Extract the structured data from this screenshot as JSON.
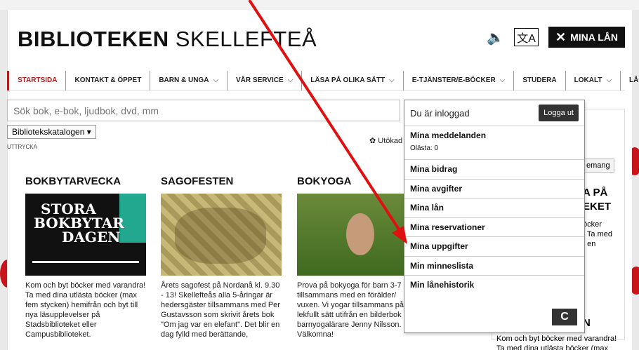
{
  "header": {
    "logo_bold": "BIBLIOTEKEN",
    "logo_light": "SKELLEFTEÅ",
    "mina_lan": "MINA LÅN",
    "icons": [
      "speaker-icon",
      "translate-icon",
      "close-icon"
    ]
  },
  "nav": {
    "items": [
      {
        "label": "STARTSIDA",
        "chev": ""
      },
      {
        "label": "KONTAKT & ÖPPET",
        "chev": ""
      },
      {
        "label": "BARN & UNGA",
        "chev": "⌵"
      },
      {
        "label": "VÅR SERVICE",
        "chev": "⌵"
      },
      {
        "label": "LÄSA PÅ OLIKA SÄTT",
        "chev": "⌵"
      },
      {
        "label": "E-TJÄNSTER/E-BÖCKER",
        "chev": "⌵"
      },
      {
        "label": "STUDERA",
        "chev": ""
      },
      {
        "label": "LOKALT",
        "chev": "⌵"
      },
      {
        "label": "LÅNA OM",
        "chev": ""
      }
    ]
  },
  "search": {
    "placeholder": "Sök bok, e-bok, ljudbok, dvd, mm",
    "catalog": "Bibliotekskatalogen ▾",
    "advanced": "✿ Utökad",
    "side_text": "UTTRYCKA"
  },
  "dropdown": {
    "status": "Du är inloggad",
    "logout": "Logga ut",
    "meddelanden": "Mina meddelanden",
    "olasta": "Olästa:  0",
    "items": [
      "Mina bidrag",
      "Mina avgifter",
      "Mina lån",
      "Mina reservationer",
      "Mina uppgifter",
      "Min minneslista",
      "Min lånehistorik"
    ],
    "refresh": "C"
  },
  "columns": [
    {
      "title": "BOKBYTARVECKA",
      "image_text": [
        "STORA",
        "BOKBYTAR",
        "DAGEN"
      ],
      "text": "Kom och byt böcker med varandra! Ta med dina utlästa böcker (max fem stycken) hemifrån och byt till nya läsupplevelser på Stadsbiblioteket eller Campusbiblioteket."
    },
    {
      "title": "SAGOFESTEN",
      "text": "Årets sagofest på Nordanå kl. 9.30 - 13! Skellefteås alla 5-åringar är hedersgäster tillsammans med Per Gustavsson som skrivit årets bok \"Om jag var en elefant\". Det blir en dag fylld med berättande,"
    },
    {
      "title": "BOKYOGA",
      "text": "Prova på bokyoga för barn 3-7 år tillsammans med en förälder/ vuxen. Vi yogar tillsammans på ett lekfullt sätt utifrån en bilderbok med barnyogalärare Jenny Nilsson. Välkomna!"
    }
  ],
  "right": {
    "tema": "emang",
    "head": "A PÅ\nEKET",
    "text": "öcker\n. Ta med\nt en",
    "n": "N",
    "bottom": "Kom och byt böcker med varandra! Ta med dina utlästa böcker (max"
  },
  "colors": {
    "accent": "#b01d1d",
    "arrow": "#e01010",
    "teal": "#22a88e"
  }
}
